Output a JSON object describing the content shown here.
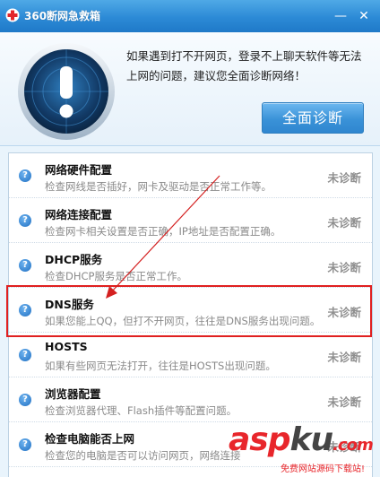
{
  "window": {
    "title": "360断网急救箱",
    "min_glyph": "—",
    "close_glyph": "✕"
  },
  "header": {
    "message": "如果遇到打不开网页，登录不上聊天软件等无法上网的问题，建议您全面诊断网络！",
    "diagnose_button": "全面诊断"
  },
  "items": [
    {
      "title": "网络硬件配置",
      "desc": "检查网线是否插好，网卡及驱动是否正常工作等。",
      "status": "未诊断"
    },
    {
      "title": "网络连接配置",
      "desc": "检查网卡相关设置是否正确，IP地址是否配置正确。",
      "status": "未诊断"
    },
    {
      "title": "DHCP服务",
      "desc": "检查DHCP服务是否正常工作。",
      "status": "未诊断"
    },
    {
      "title": "DNS服务",
      "desc": "如果您能上QQ，但打不开网页，往往是DNS服务出现问题。",
      "status": "未诊断"
    },
    {
      "title": "HOSTS",
      "desc": "如果有些网页无法打开，往往是HOSTS出现问题。",
      "status": "未诊断"
    },
    {
      "title": "浏览器配置",
      "desc": "检查浏览器代理、Flash插件等配置问题。",
      "status": "未诊断"
    },
    {
      "title": "检查电脑能否上网",
      "desc": "检查您的电脑是否可以访问网页，网络连接",
      "status": "未诊断"
    }
  ],
  "watermark": {
    "brand_a": "asp",
    "brand_k": "ku",
    "brand_com": ".com",
    "tagline": "免费网站源码下载站!"
  },
  "colors": {
    "accent": "#2c8ad6",
    "highlight": "#e02020"
  },
  "icons": {
    "logo": "360-cross-icon",
    "alert": "exclamation-radar-icon",
    "row": "question-circle-icon"
  }
}
